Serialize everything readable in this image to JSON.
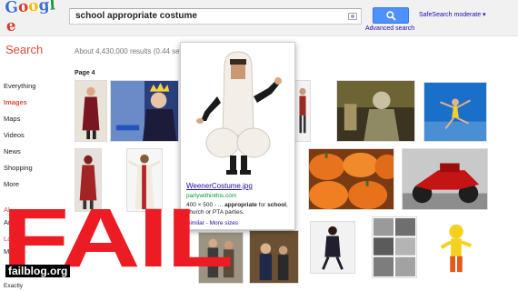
{
  "header": {
    "logo_text": "Google",
    "search_query": "school appropriate costume",
    "search_button_icon": "search-icon",
    "advanced_search": "Advanced search",
    "safesearch": "SafeSearch moderate ▾"
  },
  "results": {
    "label": "Search",
    "count": "About 4,430,000 results (0.44 sec",
    "page": "Page 4"
  },
  "sidebar": {
    "items": [
      {
        "label": "Everything",
        "active": false
      },
      {
        "label": "Images",
        "active": true
      },
      {
        "label": "Maps",
        "active": false
      },
      {
        "label": "Videos",
        "active": false
      },
      {
        "label": "News",
        "active": false
      },
      {
        "label": "Shopping",
        "active": false
      },
      {
        "label": "More",
        "active": false
      }
    ],
    "partial_1": "Al",
    "partial_2": "Ar",
    "partial_3": "La",
    "partial_4": "M",
    "partial_5": "Exactly"
  },
  "popup": {
    "title": "WeenerCostume.jpg",
    "url": "partywithinthis.com",
    "desc_prefix": "400 × 500 - ... ",
    "desc_bold1": "appropriate",
    "desc_mid": " for ",
    "desc_bold2": "school",
    "desc_suffix": ", church or PTA parties.",
    "links": "Similar - More sizes"
  },
  "overlay": {
    "fail_text": "FAIL",
    "watermark": "failblog.org"
  },
  "colors": {
    "accent_red": "#dd4b39",
    "link_blue": "#1a0dab",
    "url_green": "#009933",
    "button_blue": "#4d90fe",
    "fail_red": "#ed1c24"
  }
}
